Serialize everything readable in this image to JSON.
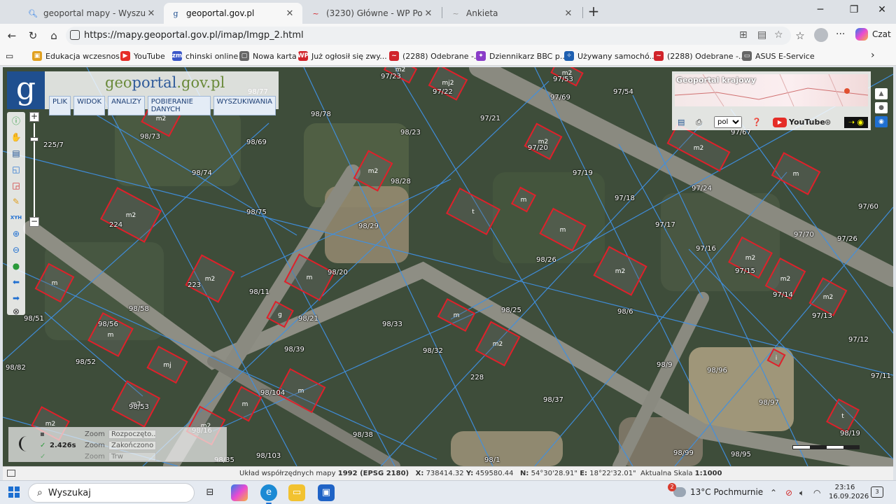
{
  "browser": {
    "tabs": [
      {
        "title": "geoportal mapy - Wyszukaj",
        "icon": "search-icon"
      },
      {
        "title": "geoportal.gov.pl",
        "icon": "geoportal-icon"
      },
      {
        "title": "(3230) Główne - WP Poczta",
        "icon": "wp-icon"
      },
      {
        "title": "Ankieta",
        "icon": "survey-icon"
      }
    ],
    "url": "https://mapy.geoportal.gov.pl/imap/Imgp_2.html",
    "copilot_label": "Czat",
    "bookmarks": [
      {
        "label": "Edukacja wczesnos...",
        "color": "#e0a020",
        "glyph": "▣"
      },
      {
        "label": "YouTube",
        "color": "#e52d27",
        "glyph": "▶"
      },
      {
        "label": "chinski online",
        "color": "#3a56c8",
        "glyph": "zm"
      },
      {
        "label": "Nowa karta",
        "color": "#666666",
        "glyph": "▢"
      },
      {
        "label": "Już ogłosił się zwy...",
        "color": "#d1232a",
        "glyph": "WP"
      },
      {
        "label": "(2288) Odebrane -...",
        "color": "#d1232a",
        "glyph": "~"
      },
      {
        "label": "Dziennikarz BBC p...",
        "color": "#8a3cc8",
        "glyph": "✦"
      },
      {
        "label": "Używany samochó...",
        "color": "#1e5fb0",
        "glyph": "✧"
      },
      {
        "label": "(2288) Odebrane -...",
        "color": "#d1232a",
        "glyph": "~"
      },
      {
        "label": "ASUS E-Service",
        "color": "#666666",
        "glyph": "▭"
      }
    ]
  },
  "geoportal": {
    "logo_letter": "g",
    "title_prefix": "geo",
    "title_main": "portal",
    "title_suffix": ".gov.pl",
    "menu": [
      "PLIK",
      "WIDOK",
      "ANALIZY",
      "POBIERANIE DANYCH",
      "WYSZUKIWANIA"
    ],
    "overview_title": "Geoportal krajowy",
    "language": "pol",
    "youtube_label": "YouTube",
    "zoom_in": "+",
    "zoom_out": "−"
  },
  "parcels": [
    {
      "label": "97/23"
    },
    {
      "label": "97/22"
    },
    {
      "label": "97/53"
    },
    {
      "label": "97/54"
    },
    {
      "label": "97/69"
    },
    {
      "label": "97/21"
    },
    {
      "label": "97/20"
    },
    {
      "label": "98/78"
    },
    {
      "label": "98/73"
    },
    {
      "label": "98/69"
    },
    {
      "label": "98/23"
    },
    {
      "label": "225/7"
    },
    {
      "label": "98/74"
    },
    {
      "label": "98/28"
    },
    {
      "label": "97/19"
    },
    {
      "label": "97/24"
    },
    {
      "label": "97/67"
    },
    {
      "label": "98/75"
    },
    {
      "label": "97/18"
    },
    {
      "label": "224"
    },
    {
      "label": "98/29"
    },
    {
      "label": "97/17"
    },
    {
      "label": "97/60"
    },
    {
      "label": "97/70"
    },
    {
      "label": "97/26"
    },
    {
      "label": "97/16"
    },
    {
      "label": "98/26"
    },
    {
      "label": "98/20"
    },
    {
      "label": "223"
    },
    {
      "label": "97/15"
    },
    {
      "label": "98/11"
    },
    {
      "label": "97/14"
    },
    {
      "label": "98/58"
    },
    {
      "label": "98/25"
    },
    {
      "label": "98/6"
    },
    {
      "label": "98/51"
    },
    {
      "label": "98/21"
    },
    {
      "label": "98/33"
    },
    {
      "label": "97/13"
    },
    {
      "label": "98/56"
    },
    {
      "label": "97/12"
    },
    {
      "label": "98/39"
    },
    {
      "label": "98/32"
    },
    {
      "label": "98/82"
    },
    {
      "label": "98/52"
    },
    {
      "label": "98/9"
    },
    {
      "label": "98/96"
    },
    {
      "label": "97/11"
    },
    {
      "label": "228"
    },
    {
      "label": "98/104"
    },
    {
      "label": "98/37"
    },
    {
      "label": "98/53"
    },
    {
      "label": "98/97"
    },
    {
      "label": "98/16"
    },
    {
      "label": "98/19"
    },
    {
      "label": "98/38"
    },
    {
      "label": "98/103"
    },
    {
      "label": "98/35"
    },
    {
      "label": "98/1"
    },
    {
      "label": "98/99"
    },
    {
      "label": "98/95"
    },
    {
      "label": "98/77"
    }
  ],
  "buildings": [
    "m2",
    "mj2",
    "m2",
    "m2",
    "m2",
    "m2",
    "t",
    "m",
    "m",
    "m2",
    "m2",
    "m2",
    "m2",
    "m2",
    "m",
    "m2",
    "m2",
    "m",
    "mj",
    "g",
    "m",
    "m2",
    "m",
    "m",
    "m",
    "m",
    "m2",
    "m2",
    "t",
    "m2",
    "i"
  ],
  "status_log": [
    {
      "time": "",
      "label": "Zoom",
      "message": "Rozpoczęto..."
    },
    {
      "time": "2.426s",
      "label": "Zoom",
      "message": "Zakończono"
    },
    {
      "time": "",
      "label": "Zoom",
      "message": "Trw"
    }
  ],
  "map_status": {
    "system_label": "Układ współrzędnych mapy",
    "system_value": "1992 (EPSG 2180)",
    "x_label": "X:",
    "x_value": "738414.32",
    "y_label": "Y:",
    "y_value": "459580.44",
    "n_label": "N:",
    "n_value": "54°30'28.91\"",
    "e_label": "E:",
    "e_value": "18°22'32.01\"",
    "scale_label": "Aktualna Skala",
    "scale_value": "1:1000"
  },
  "taskbar": {
    "search_label": "Wyszukaj",
    "weather_text": "13°C Pochmurnie",
    "weather_badge": "2",
    "time": "23:16",
    "date": "16.09.2026",
    "notifications": "3"
  },
  "colors": {
    "parcel_line": "#3f8fe0",
    "building_outline": "#e0202a",
    "geoportal_blue": "#1f4f8f"
  }
}
